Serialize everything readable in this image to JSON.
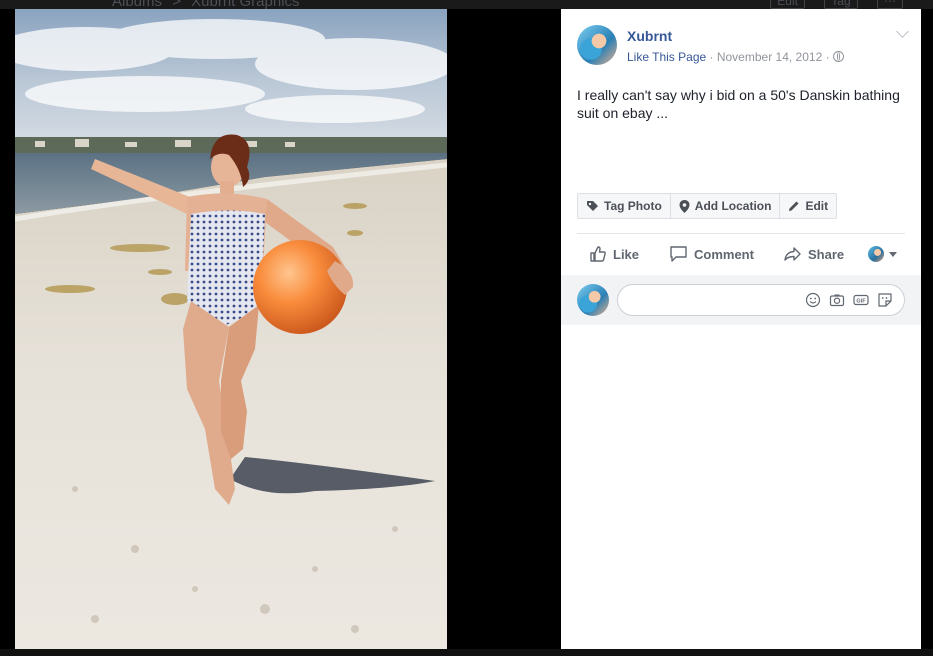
{
  "breadcrumb": {
    "albums": "Albums",
    "separator": ">",
    "album_name": "Xubrnt Graphics"
  },
  "top_actions": {
    "edit": "Edit",
    "tag": "Tag"
  },
  "post": {
    "page_name": "Xubrnt",
    "like_page": "Like This Page",
    "dot": " · ",
    "date": "November 14, 2012",
    "caption": "I really can't say why i bid on a 50's Danskin bathing suit on ebay ...",
    "privacy_icon": "globe-icon"
  },
  "photo_actions": {
    "tag_photo": "Tag Photo",
    "add_location": "Add Location",
    "edit": "Edit"
  },
  "reactions": {
    "like": "Like",
    "comment": "Comment",
    "share": "Share"
  },
  "comment_box": {
    "placeholder": "",
    "icons": [
      "emoji-icon",
      "camera-icon",
      "gif-icon",
      "sticker-icon"
    ]
  },
  "colors": {
    "link": "#365899",
    "muted": "#90949c",
    "text": "#1d2129",
    "action": "#606770"
  }
}
